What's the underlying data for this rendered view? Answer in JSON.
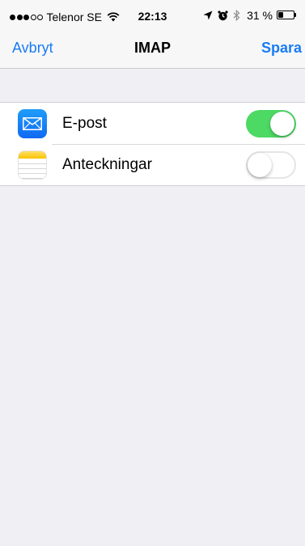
{
  "status_bar": {
    "carrier": "Telenor SE",
    "signal_filled": 3,
    "signal_total": 5,
    "time": "22:13",
    "battery_percent_text": "31 %",
    "battery_level": 0.31,
    "icons": [
      "location-icon",
      "alarm-icon",
      "bluetooth-icon",
      "wifi-icon"
    ]
  },
  "nav": {
    "cancel_label": "Avbryt",
    "title": "IMAP",
    "save_label": "Spara"
  },
  "rows": [
    {
      "label": "E-post",
      "icon": "mail-icon",
      "enabled": true
    },
    {
      "label": "Anteckningar",
      "icon": "notes-icon",
      "enabled": false
    }
  ],
  "colors": {
    "accent": "#1a7cf5",
    "toggle_on": "#4cd964",
    "background": "#efeff4"
  }
}
